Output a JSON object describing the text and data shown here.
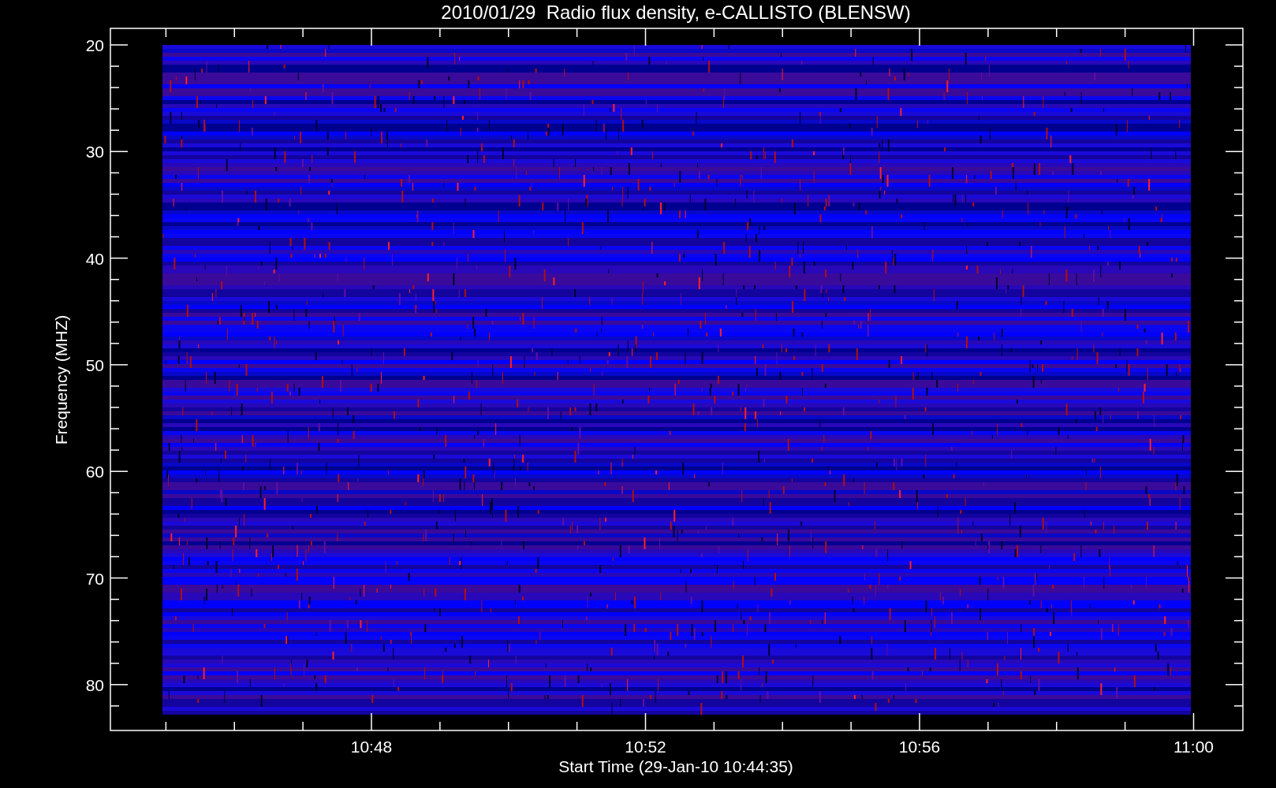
{
  "plot": {
    "title": "2010/01/29  Radio flux density, e-CALLISTO (BLENSW)",
    "xlabel": "Start Time (29-Jan-10 10:44:35)",
    "ylabel": "Frequency (MHZ)",
    "xtick_labels": [
      "10:48",
      "10:52",
      "10:56",
      "11:00"
    ],
    "ytick_labels": [
      "20",
      "30",
      "40",
      "50",
      "60",
      "70",
      "80"
    ]
  }
}
